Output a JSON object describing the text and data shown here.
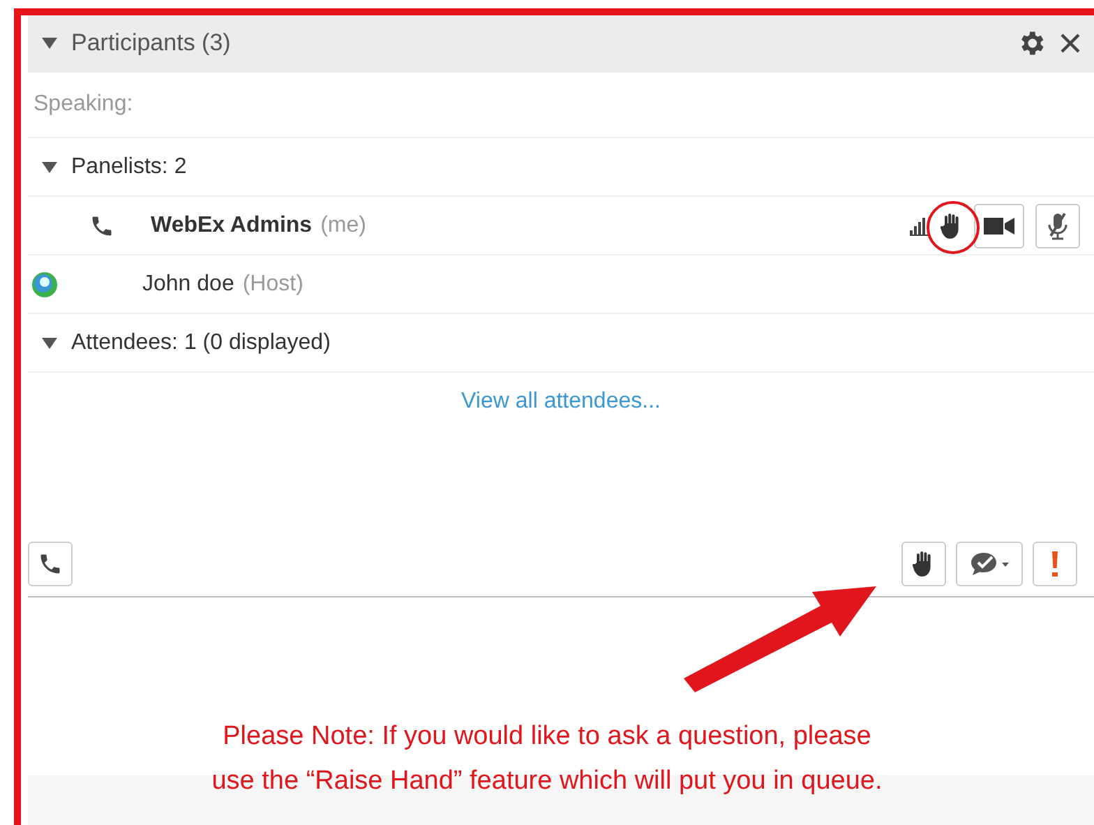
{
  "panel": {
    "title": "Participants (3)"
  },
  "speaking": "Speaking:",
  "panelists": {
    "label": "Panelists: 2",
    "members": [
      {
        "name": "WebEx Admins",
        "tag": "(me)",
        "kind": "phone",
        "is_me": true,
        "hand_highlighted": true
      },
      {
        "name": "John doe",
        "tag": "(Host)",
        "kind": "host",
        "is_me": false
      }
    ]
  },
  "attendees": {
    "label": "Attendees: 1 (0 displayed)",
    "link": "View all attendees..."
  },
  "note": [
    "Please Note:  If you would like to ask a question, please",
    "use the “Raise Hand” feature which will put you in queue."
  ]
}
